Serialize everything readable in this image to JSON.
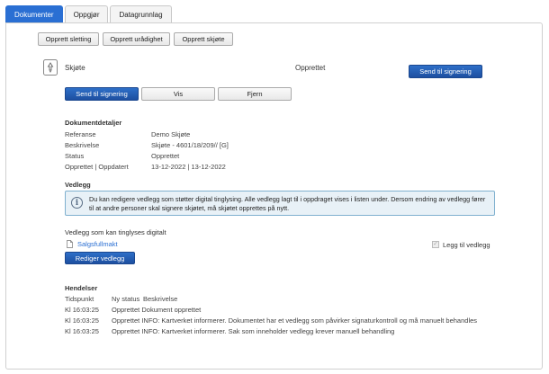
{
  "tabs": [
    {
      "label": "Dokumenter",
      "active": true
    },
    {
      "label": "Oppgjør",
      "active": false
    },
    {
      "label": "Datagrunnlag",
      "active": false
    }
  ],
  "toolbar": {
    "create_deletion": "Opprett sletting",
    "create_restraint": "Opprett urådighet",
    "create_deed": "Opprett skjøte"
  },
  "document": {
    "name": "Skjøte",
    "status": "Opprettet",
    "send_signing_top": "Send til signering",
    "send_signing": "Send til signering",
    "view": "Vis",
    "remove": "Fjern"
  },
  "details": {
    "title": "Dokumentdetaljer",
    "rows": [
      {
        "label": "Referanse",
        "value": "Demo Skjøte"
      },
      {
        "label": "Beskrivelse",
        "value": "Skjøte - 4601/18/209// [G]"
      },
      {
        "label": "Status",
        "value": "Opprettet"
      },
      {
        "label": "Opprettet | Oppdatert",
        "value": "13-12-2022 | 13-12-2022"
      }
    ]
  },
  "attachments": {
    "title": "Vedlegg",
    "info_text": "Du kan redigere vedlegg som støtter digital tinglysing. Alle vedlegg lagt til i oppdraget vises i listen under. Dersom endring av vedlegg fører til at andre personer skal signere skjøtet, må skjøtet opprettes på nytt.",
    "digital_title": "Vedlegg som kan tinglyses digitalt",
    "item_name": "Salgsfullmakt",
    "add_label": "Legg til vedlegg",
    "add_checked": true,
    "edit_button": "Rediger vedlegg"
  },
  "events": {
    "title": "Hendelser",
    "headers": {
      "time": "Tidspunkt",
      "status": "Ny status",
      "desc": "Beskrivelse"
    },
    "rows": [
      {
        "time": "Kl 16:03:25",
        "text": "Opprettet Dokument opprettet"
      },
      {
        "time": "Kl 16:03:25",
        "text": "Opprettet INFO: Kartverket informerer. Dokumentet har et vedlegg som påvirker signaturkontroll og må manuelt behandles"
      },
      {
        "time": "Kl 16:03:25",
        "text": "Opprettet INFO: Kartverket informerer. Sak som inneholder vedlegg krever manuell behandling"
      }
    ]
  },
  "colors": {
    "primary": "#2a6fd3",
    "info_bg": "#e8f1f7",
    "info_border": "#7fb0cf"
  },
  "icons": {
    "document": "document-icon",
    "info": "info-icon",
    "file": "file-icon"
  }
}
